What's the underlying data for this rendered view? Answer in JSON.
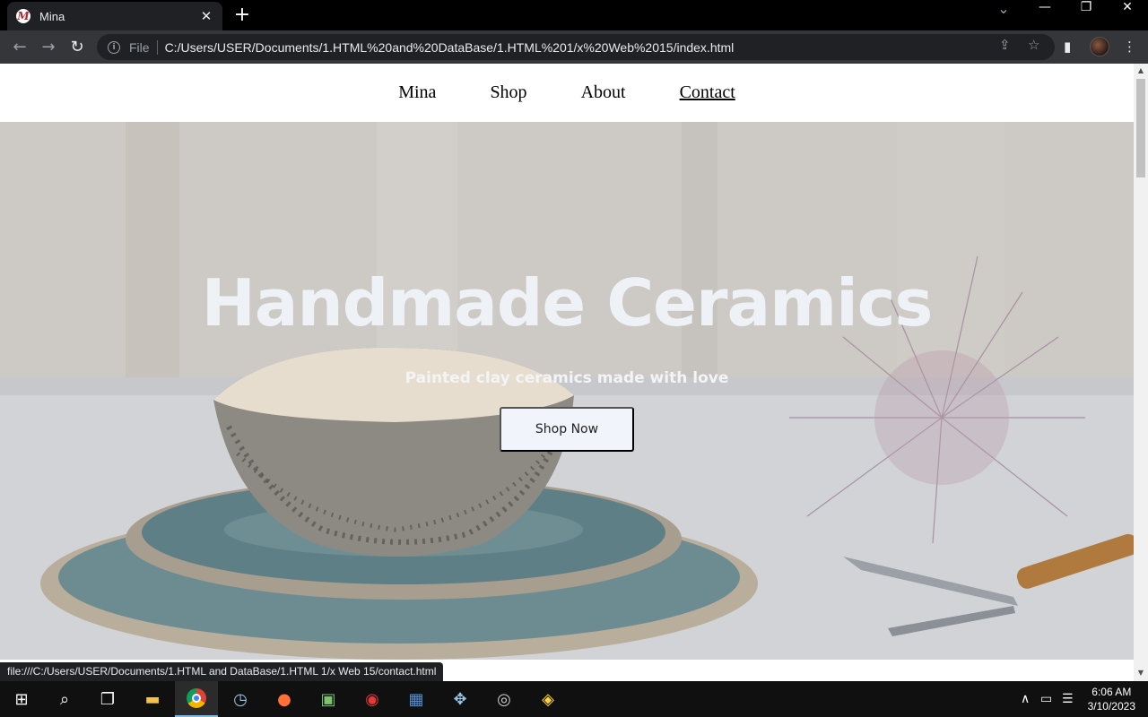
{
  "browser": {
    "tab_title": "Mina",
    "tab_favicon_letter": "M",
    "new_tab": "+",
    "close_tab": "✕",
    "minimize": "—",
    "restore": "❐",
    "close_window": "✕",
    "dropdown": "⌄",
    "chip": "File",
    "url": "C:/Users/USER/Documents/1.HTML%20and%20DataBase/1.HTML%201/x%20Web%2015/index.html",
    "status_url": "file:///C:/Users/USER/Documents/1.HTML and DataBase/1.HTML 1/x Web 15/contact.html"
  },
  "site": {
    "nav": [
      "Mina",
      "Shop",
      "About",
      "Contact"
    ],
    "active_nav": "Contact",
    "hero_title": "Handmade Ceramics",
    "hero_subtitle": "Painted clay ceramics made with love",
    "hero_button": "Shop Now"
  },
  "taskbar": {
    "apps": [
      "windows-start",
      "search",
      "task-view",
      "file-explorer",
      "chrome",
      "clock-app",
      "firefox",
      "android-studio",
      "screen-recorder",
      "calculator",
      "game-controller",
      "obs",
      "python"
    ],
    "active_app": "chrome",
    "time": "6:06 AM",
    "date": "3/10/2023"
  },
  "colors": {
    "hero_text": "#eef2f7",
    "button_bg": "#f1f5fb",
    "toolbar": "#35363a",
    "tab": "#202124"
  }
}
